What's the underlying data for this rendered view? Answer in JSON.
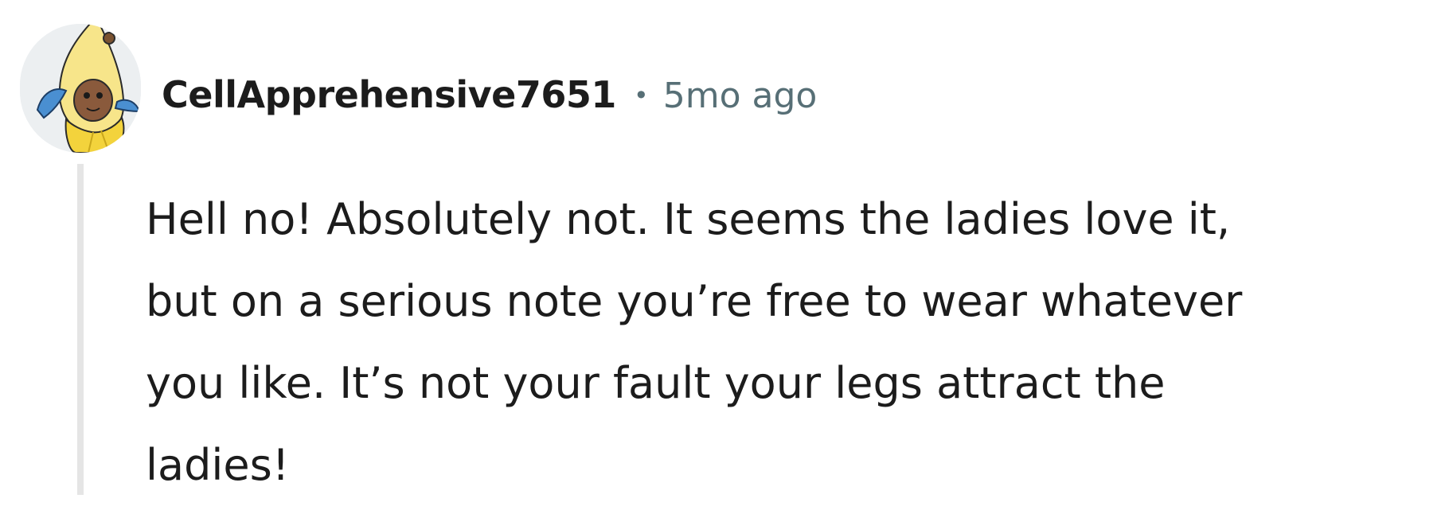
{
  "comment": {
    "author": "CellApprehensive7651",
    "separator": "•",
    "timestamp": "5mo ago",
    "avatar_icon": "banana-costume-avatar-icon",
    "body_lines": [
      "Hell no! Absolutely not. It seems the ladies love it,",
      "but on a serious note you’re free to wear whatever",
      "you like. It’s not your fault your legs attract the",
      "ladies!"
    ]
  },
  "colors": {
    "author": "#1c1c1c",
    "meta": "#576f76",
    "body": "#1c1c1c",
    "thread_line": "#e5e5e5"
  }
}
